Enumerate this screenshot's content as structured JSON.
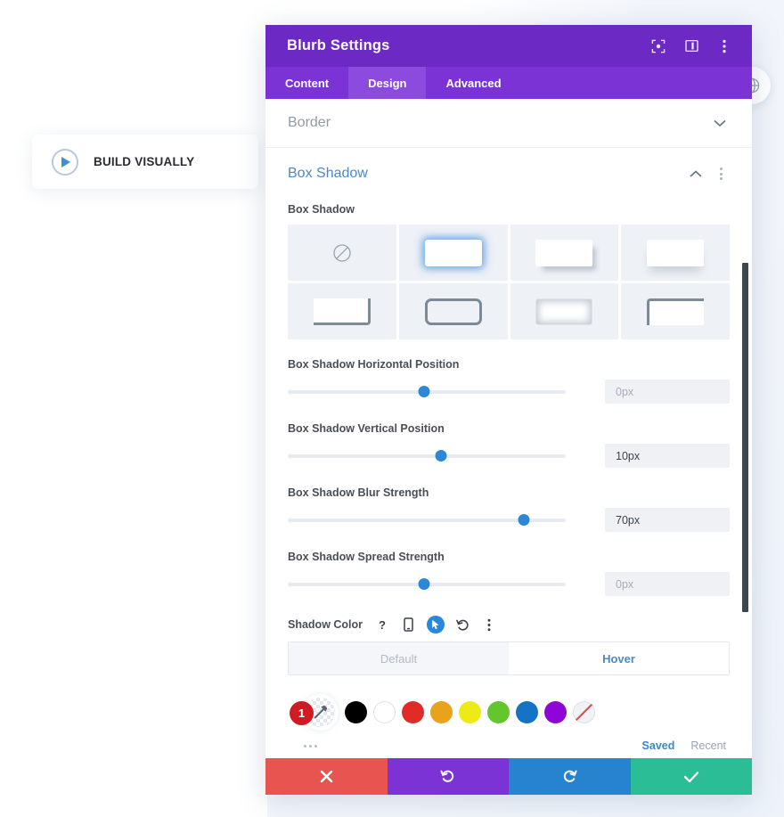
{
  "page": {
    "build_visually": {
      "label": "BUILD VISUALLY",
      "icon": "play-circle-icon"
    },
    "globe_icon": "globe-icon"
  },
  "modal": {
    "title": "Blurb Settings",
    "header_icons": [
      {
        "name": "focus-target-icon"
      },
      {
        "name": "layout-columns-icon"
      },
      {
        "name": "kebab-menu-icon"
      }
    ],
    "tabs": [
      {
        "label": "Content",
        "active": false
      },
      {
        "label": "Design",
        "active": true
      },
      {
        "label": "Advanced",
        "active": false
      }
    ],
    "sections": [
      {
        "title": "Border",
        "open": false,
        "chevron": "chevron-down-icon"
      },
      {
        "title": "Box Shadow",
        "open": true,
        "chevron": "chevron-up-icon"
      }
    ],
    "box_shadow": {
      "group_label": "Box Shadow",
      "presets": [
        {
          "name": "preset-none",
          "style": "p-none",
          "selected": false
        },
        {
          "name": "preset-glow",
          "style": "p-glow",
          "selected": true
        },
        {
          "name": "preset-drop",
          "style": "p-drop",
          "selected": false
        },
        {
          "name": "preset-soft-bottom",
          "style": "p-soft",
          "selected": false
        },
        {
          "name": "preset-corner",
          "style": "p-corner",
          "selected": false
        },
        {
          "name": "preset-outline",
          "style": "p-outline",
          "selected": false
        },
        {
          "name": "preset-inner",
          "style": "p-inner",
          "selected": false
        },
        {
          "name": "preset-top-left",
          "style": "p-topleft",
          "selected": false
        }
      ],
      "sliders": [
        {
          "label": "Box Shadow Horizontal Position",
          "value": "0px",
          "is_placeholder": true,
          "knob_percent": 49
        },
        {
          "label": "Box Shadow Vertical Position",
          "value": "10px",
          "is_placeholder": false,
          "knob_percent": 55
        },
        {
          "label": "Box Shadow Blur Strength",
          "value": "70px",
          "is_placeholder": false,
          "knob_percent": 85
        },
        {
          "label": "Box Shadow Spread Strength",
          "value": "0px",
          "is_placeholder": true,
          "knob_percent": 49
        }
      ],
      "shadow_color": {
        "label": "Shadow Color",
        "icons": [
          {
            "name": "help-question-icon",
            "glyph": "?"
          },
          {
            "name": "mobile-device-icon",
            "glyph": ""
          },
          {
            "name": "cursor-pointer-icon",
            "glyph": ""
          },
          {
            "name": "reset-undo-icon",
            "glyph": ""
          },
          {
            "name": "kebab-menu-icon",
            "glyph": ""
          }
        ],
        "states": [
          {
            "label": "Default",
            "active": false
          },
          {
            "label": "Hover",
            "active": true
          }
        ],
        "picker": {
          "badge": "1",
          "eyedropper_icon": "eyedropper-icon"
        },
        "swatches": [
          {
            "name": "swatch-black",
            "color": "#000000",
            "bordered": false
          },
          {
            "name": "swatch-white",
            "color": "#ffffff",
            "bordered": true
          },
          {
            "name": "swatch-red",
            "color": "#e02b27",
            "bordered": false
          },
          {
            "name": "swatch-orange",
            "color": "#e8a21c",
            "bordered": false
          },
          {
            "name": "swatch-yellow",
            "color": "#eeea16",
            "bordered": false
          },
          {
            "name": "swatch-green",
            "color": "#62c62c",
            "bordered": false
          },
          {
            "name": "swatch-blue",
            "color": "#1473c4",
            "bordered": false
          },
          {
            "name": "swatch-purple",
            "color": "#8f05d6",
            "bordered": false
          },
          {
            "name": "swatch-transparent",
            "color": "transparent",
            "bordered": true
          }
        ],
        "more_icon": "ellipsis-icon",
        "saved_label": "Saved",
        "recent_label": "Recent"
      }
    },
    "footer_buttons": [
      {
        "name": "cancel-button",
        "icon": "close-x-icon",
        "color": "#e8544f"
      },
      {
        "name": "undo-button",
        "icon": "undo-icon",
        "color": "#7b33d6"
      },
      {
        "name": "redo-button",
        "icon": "redo-icon",
        "color": "#2683cf"
      },
      {
        "name": "save-button",
        "icon": "checkmark-icon",
        "color": "#2bbd96"
      }
    ]
  },
  "colors": {
    "header_purple": "#6d29c4",
    "tabs_purple": "#7b33d6",
    "tab_active_purple": "#8c4ade",
    "accent_blue": "#2b87da",
    "link_blue": "#4c89c4"
  }
}
